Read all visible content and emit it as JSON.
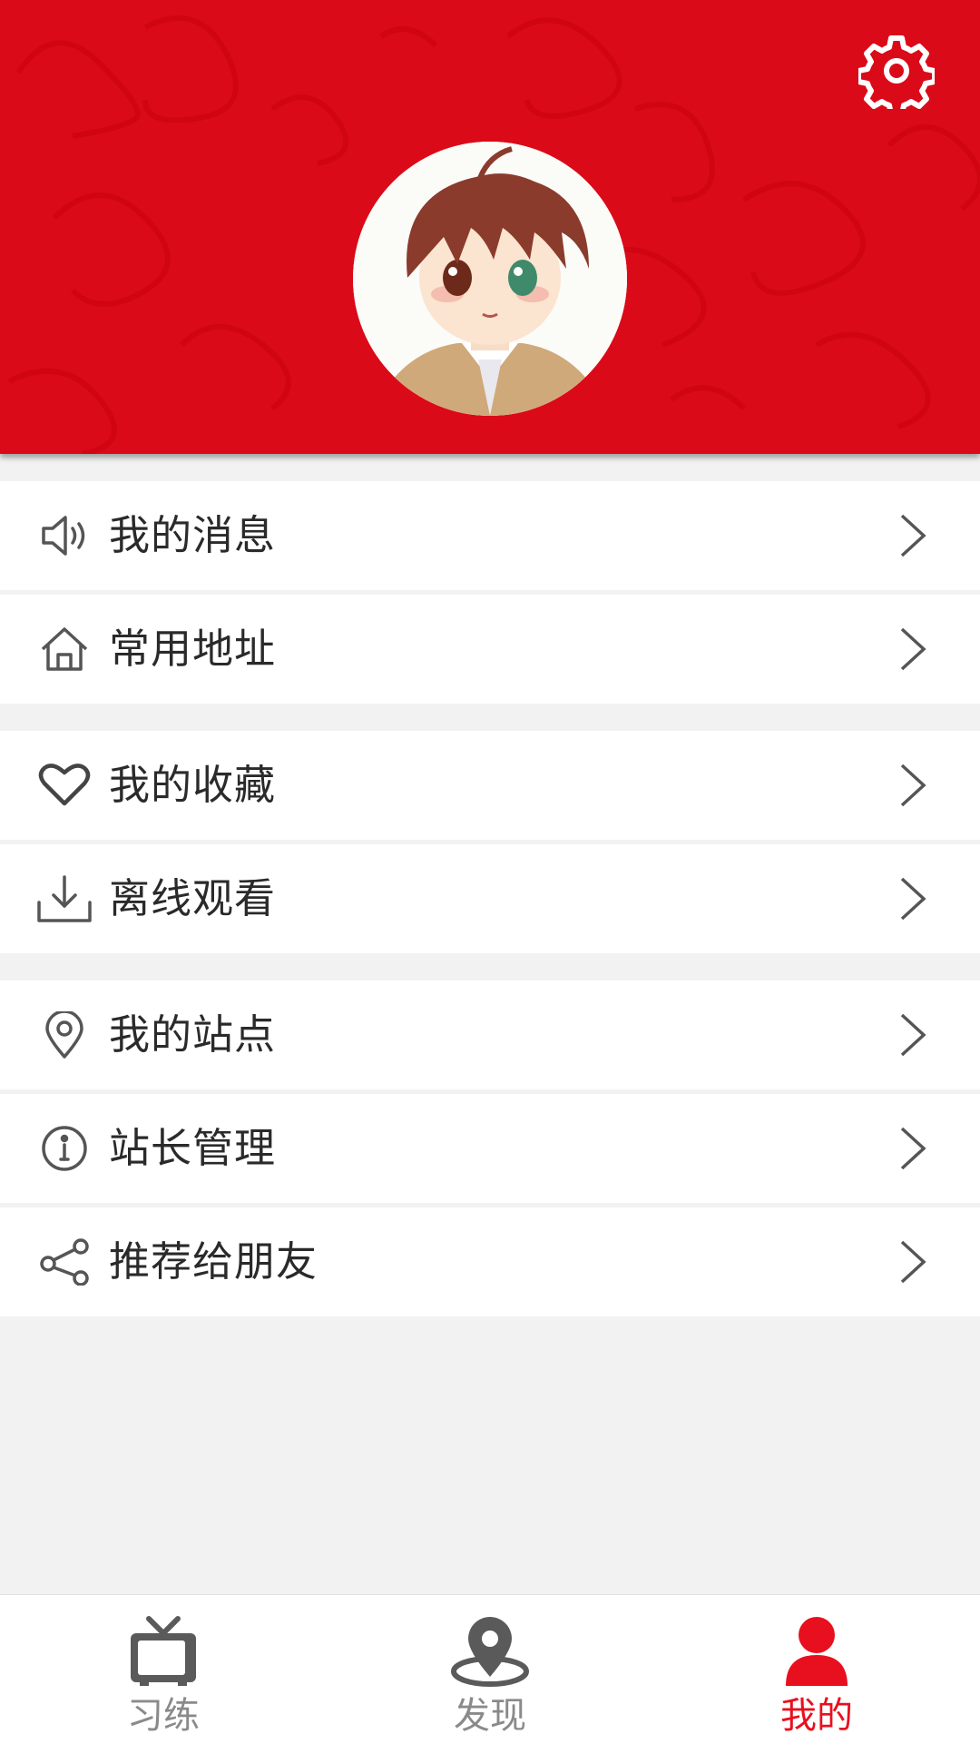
{
  "header": {
    "background_color": "#db0a18",
    "settings_icon": "gear-icon",
    "avatar_description": "anime-avatar"
  },
  "menu": {
    "groups": [
      {
        "items": [
          {
            "label": "我的消息",
            "icon": "speaker-icon"
          },
          {
            "label": "常用地址",
            "icon": "home-icon"
          }
        ]
      },
      {
        "items": [
          {
            "label": "我的收藏",
            "icon": "heart-icon"
          },
          {
            "label": "离线观看",
            "icon": "download-icon"
          }
        ]
      },
      {
        "items": [
          {
            "label": "我的站点",
            "icon": "location-pin-icon"
          },
          {
            "label": "站长管理",
            "icon": "info-icon"
          },
          {
            "label": "推荐给朋友",
            "icon": "share-icon"
          }
        ]
      }
    ]
  },
  "bottom_nav": {
    "items": [
      {
        "label": "习练",
        "icon": "tv-icon",
        "active": false
      },
      {
        "label": "发现",
        "icon": "map-pin-icon",
        "active": false
      },
      {
        "label": "我的",
        "icon": "person-icon",
        "active": true
      }
    ],
    "active_color": "#e8101e",
    "inactive_color": "#8a8a8a"
  }
}
